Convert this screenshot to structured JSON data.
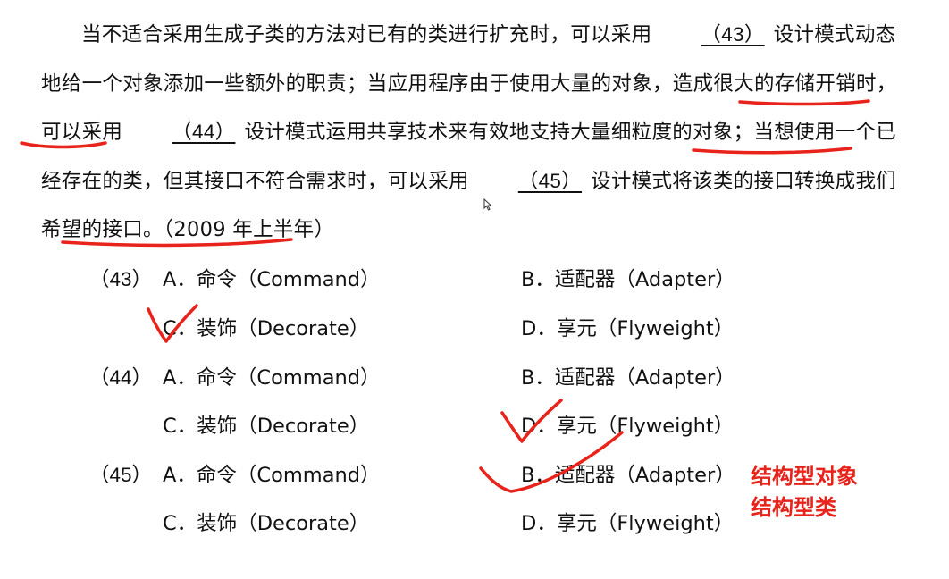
{
  "paragraph": {
    "p1": "当不适合采用生成子类的方法对已有的类进行扩充时，可以采用",
    "blank43": "（43）",
    "p2": "设计模式动态地给一个对象添加一些额外的职责；当应用程序由于使用大量的对象，造成很大的存储开销时，可以采用",
    "blank44": "（44）",
    "p3": "设计模式运用共享技术来有效地支持大量细粒度的对象；当想使用一个已经存在的类，但其接口不符合需求时，可以采用",
    "blank45": "（45）",
    "p4": "设计模式将该类的接口转换成我们希望的接口。（2009 年上半年）"
  },
  "questions": [
    {
      "number": "（43）",
      "options": [
        "A．命令（Command）",
        "B．适配器（Adapter）",
        "C．装饰（Decorate）",
        "D．享元（Flyweight）"
      ]
    },
    {
      "number": "（44）",
      "options": [
        "A．命令（Command）",
        "B．适配器（Adapter）",
        "C．装饰（Decorate）",
        "D．享元（Flyweight）"
      ]
    },
    {
      "number": "（45）",
      "options": [
        "A．命令（Command）",
        "B．适配器（Adapter）",
        "C．装饰（Decorate）",
        "D．享元（Flyweight）"
      ]
    }
  ],
  "annotations": {
    "note1": "结构型对象",
    "note2": "结构型类"
  },
  "colors": {
    "ink": "#e8231b",
    "text": "#111111"
  }
}
